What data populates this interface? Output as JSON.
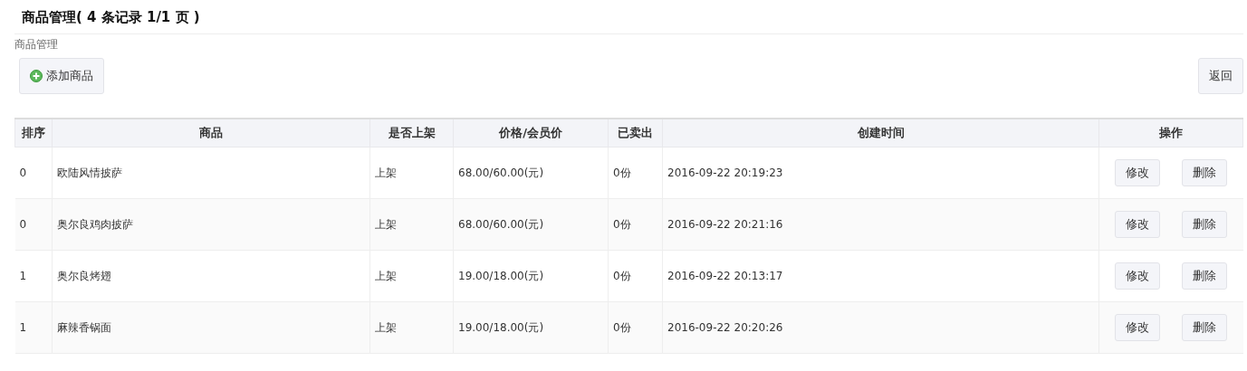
{
  "page_title": "商品管理( 4 条记录 1/1 页 )",
  "breadcrumb": "商品管理",
  "add_button": "添加商品",
  "back_button": "返回",
  "table": {
    "columns": [
      "排序",
      "商品",
      "是否上架",
      "价格/会员价",
      "已卖出",
      "创建时间",
      "操作"
    ],
    "rows": [
      {
        "cells": [
          "0",
          "欧陆风情披萨",
          "上架",
          "68.00/60.00(元)",
          "0份",
          "2016-09-22 20:19:23"
        ],
        "actions": [
          "修改",
          "删除"
        ]
      },
      {
        "cells": [
          "0",
          "奥尔良鸡肉披萨",
          "上架",
          "68.00/60.00(元)",
          "0份",
          "2016-09-22 20:21:16"
        ],
        "actions": [
          "修改",
          "删除"
        ]
      },
      {
        "cells": [
          "1",
          "奥尔良烤翅",
          "上架",
          "19.00/18.00(元)",
          "0份",
          "2016-09-22 20:13:17"
        ],
        "actions": [
          "修改",
          "删除"
        ]
      },
      {
        "cells": [
          "1",
          "麻辣香锅面",
          "上架",
          "19.00/18.00(元)",
          "0份",
          "2016-09-22 20:20:26"
        ],
        "actions": [
          "修改",
          "删除"
        ]
      }
    ]
  }
}
